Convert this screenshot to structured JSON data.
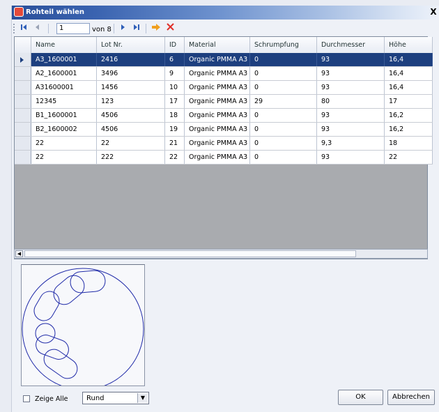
{
  "window": {
    "title": "Rohteil wählen",
    "close_glyph": "X"
  },
  "navigator": {
    "position": "1",
    "of_label": "von 8",
    "icons": [
      "move-first-icon",
      "move-previous-icon",
      "move-next-icon",
      "move-last-icon",
      "add-new-icon",
      "delete-icon"
    ]
  },
  "grid": {
    "columns": [
      "Name",
      "Lot Nr.",
      "ID",
      "Material",
      "Schrumpfung",
      "Durchmesser",
      "Höhe"
    ],
    "rows": [
      [
        "A3_1600001",
        "2416",
        "6",
        "Organic PMMA A3",
        "0",
        "93",
        "16,4"
      ],
      [
        "A2_1600001",
        "3496",
        "9",
        "Organic PMMA A3",
        "0",
        "93",
        "16,4"
      ],
      [
        "A31600001",
        "1456",
        "10",
        "Organic PMMA A3",
        "0",
        "93",
        "16,4"
      ],
      [
        "12345",
        "123",
        "17",
        "Organic PMMA A3",
        "29",
        "80",
        "17"
      ],
      [
        "B1_1600001",
        "4506",
        "18",
        "Organic PMMA A3",
        "0",
        "93",
        "16,2"
      ],
      [
        "B2_1600002",
        "4506",
        "19",
        "Organic PMMA A3",
        "0",
        "93",
        "16,2"
      ],
      [
        "22",
        "22",
        "21",
        "Organic PMMA A3",
        "0",
        "9,3",
        "18"
      ],
      [
        "22",
        "222",
        "22",
        "Organic PMMA A3",
        "0",
        "93",
        "22"
      ]
    ],
    "selected_row": 0
  },
  "options": {
    "show_all_label": "Zeige Alle",
    "show_all_checked": false,
    "shape_value": "Rund"
  },
  "buttons": {
    "ok": "OK",
    "cancel": "Abbrechen"
  },
  "colors": {
    "selection": "#1d3f7f",
    "outline": "#1f2aa8",
    "grid_bg": "#a9abaf"
  }
}
